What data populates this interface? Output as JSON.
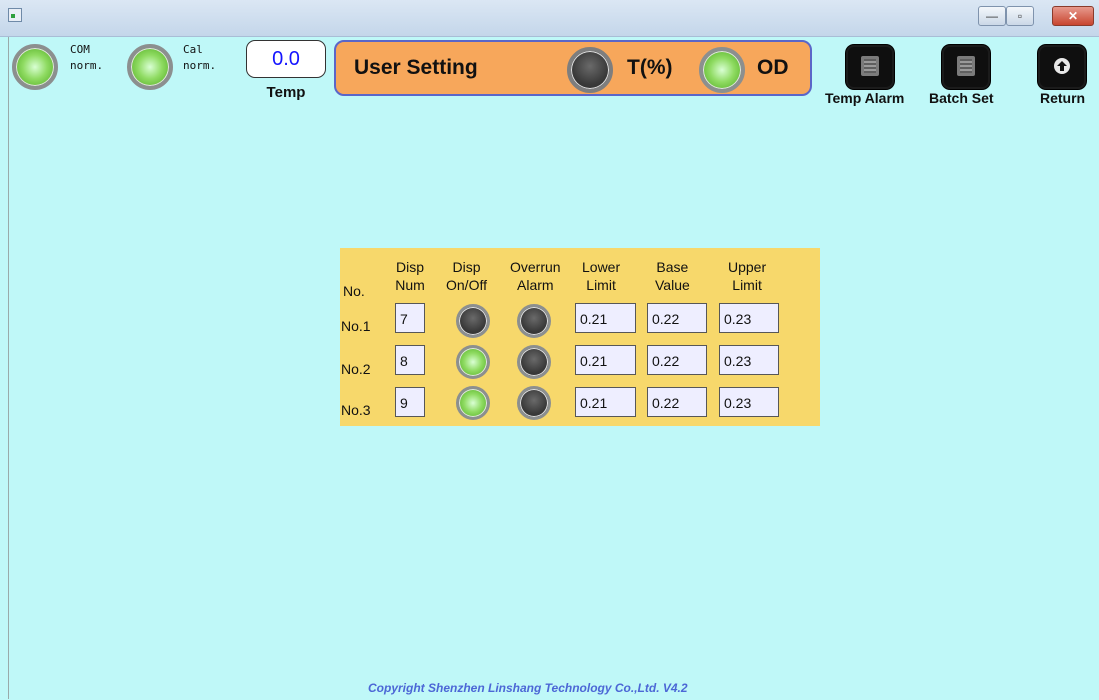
{
  "titlebar": {
    "minimize_glyph": "—",
    "maximize_glyph": "▫",
    "close_glyph": "✕"
  },
  "status": {
    "com": {
      "label": "COM",
      "state": "norm."
    },
    "cal": {
      "label": "Cal",
      "state": "norm."
    }
  },
  "temp": {
    "value": "0.0",
    "label": "Temp"
  },
  "header": {
    "title": "User Setting",
    "t_label": "T(%)",
    "od_label": "OD"
  },
  "buttons": {
    "temp_alarm": "Temp Alarm",
    "batch_set": "Batch Set",
    "return": "Return"
  },
  "table": {
    "headers": {
      "no": "No.",
      "disp_num": "Disp\nNum",
      "disp_onoff": "Disp\nOn/Off",
      "overrun_alarm": "Overrun\nAlarm",
      "lower_limit": "Lower\nLimit",
      "base_value": "Base\nValue",
      "upper_limit": "Upper\nLimit"
    },
    "rows": [
      {
        "label": "No.1",
        "disp_num": "7",
        "lower": "0.21",
        "base": "0.22",
        "upper": "0.23",
        "disp_on": false,
        "overrun_on": false
      },
      {
        "label": "No.2",
        "disp_num": "8",
        "lower": "0.21",
        "base": "0.22",
        "upper": "0.23",
        "disp_on": true,
        "overrun_on": false
      },
      {
        "label": "No.3",
        "disp_num": "9",
        "lower": "0.21",
        "base": "0.22",
        "upper": "0.23",
        "disp_on": true,
        "overrun_on": false
      }
    ]
  },
  "footer": {
    "copyright": "Copyright Shenzhen Linshang Technology Co.,Ltd. V4.2"
  },
  "colors": {
    "background": "#bff8f8",
    "panel": "#f7d86b",
    "header_bar": "#f7a75b",
    "temp_value": "#1414ff",
    "copyright": "#4c67d6"
  }
}
